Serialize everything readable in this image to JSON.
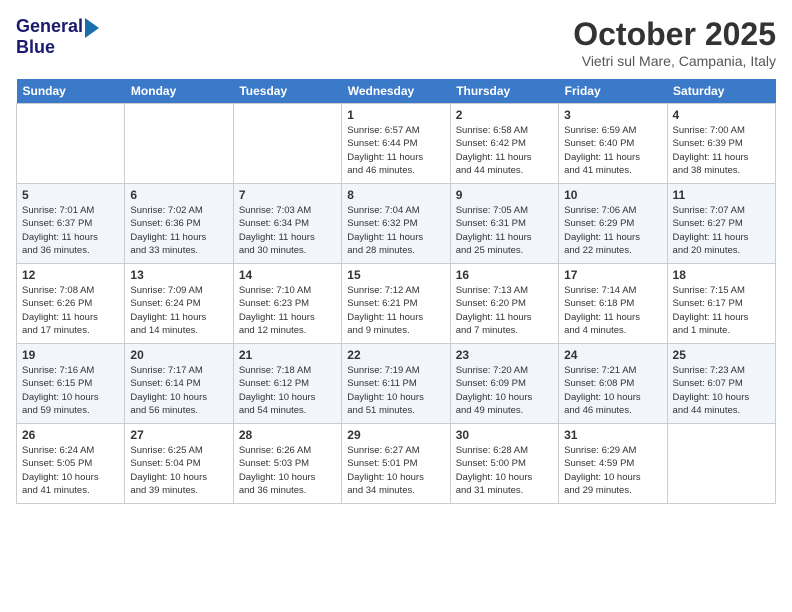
{
  "header": {
    "logo_line1": "General",
    "logo_line2": "Blue",
    "month": "October 2025",
    "location": "Vietri sul Mare, Campania, Italy"
  },
  "weekdays": [
    "Sunday",
    "Monday",
    "Tuesday",
    "Wednesday",
    "Thursday",
    "Friday",
    "Saturday"
  ],
  "weeks": [
    [
      {
        "day": "",
        "info": ""
      },
      {
        "day": "",
        "info": ""
      },
      {
        "day": "",
        "info": ""
      },
      {
        "day": "1",
        "info": "Sunrise: 6:57 AM\nSunset: 6:44 PM\nDaylight: 11 hours\nand 46 minutes."
      },
      {
        "day": "2",
        "info": "Sunrise: 6:58 AM\nSunset: 6:42 PM\nDaylight: 11 hours\nand 44 minutes."
      },
      {
        "day": "3",
        "info": "Sunrise: 6:59 AM\nSunset: 6:40 PM\nDaylight: 11 hours\nand 41 minutes."
      },
      {
        "day": "4",
        "info": "Sunrise: 7:00 AM\nSunset: 6:39 PM\nDaylight: 11 hours\nand 38 minutes."
      }
    ],
    [
      {
        "day": "5",
        "info": "Sunrise: 7:01 AM\nSunset: 6:37 PM\nDaylight: 11 hours\nand 36 minutes."
      },
      {
        "day": "6",
        "info": "Sunrise: 7:02 AM\nSunset: 6:36 PM\nDaylight: 11 hours\nand 33 minutes."
      },
      {
        "day": "7",
        "info": "Sunrise: 7:03 AM\nSunset: 6:34 PM\nDaylight: 11 hours\nand 30 minutes."
      },
      {
        "day": "8",
        "info": "Sunrise: 7:04 AM\nSunset: 6:32 PM\nDaylight: 11 hours\nand 28 minutes."
      },
      {
        "day": "9",
        "info": "Sunrise: 7:05 AM\nSunset: 6:31 PM\nDaylight: 11 hours\nand 25 minutes."
      },
      {
        "day": "10",
        "info": "Sunrise: 7:06 AM\nSunset: 6:29 PM\nDaylight: 11 hours\nand 22 minutes."
      },
      {
        "day": "11",
        "info": "Sunrise: 7:07 AM\nSunset: 6:27 PM\nDaylight: 11 hours\nand 20 minutes."
      }
    ],
    [
      {
        "day": "12",
        "info": "Sunrise: 7:08 AM\nSunset: 6:26 PM\nDaylight: 11 hours\nand 17 minutes."
      },
      {
        "day": "13",
        "info": "Sunrise: 7:09 AM\nSunset: 6:24 PM\nDaylight: 11 hours\nand 14 minutes."
      },
      {
        "day": "14",
        "info": "Sunrise: 7:10 AM\nSunset: 6:23 PM\nDaylight: 11 hours\nand 12 minutes."
      },
      {
        "day": "15",
        "info": "Sunrise: 7:12 AM\nSunset: 6:21 PM\nDaylight: 11 hours\nand 9 minutes."
      },
      {
        "day": "16",
        "info": "Sunrise: 7:13 AM\nSunset: 6:20 PM\nDaylight: 11 hours\nand 7 minutes."
      },
      {
        "day": "17",
        "info": "Sunrise: 7:14 AM\nSunset: 6:18 PM\nDaylight: 11 hours\nand 4 minutes."
      },
      {
        "day": "18",
        "info": "Sunrise: 7:15 AM\nSunset: 6:17 PM\nDaylight: 11 hours\nand 1 minute."
      }
    ],
    [
      {
        "day": "19",
        "info": "Sunrise: 7:16 AM\nSunset: 6:15 PM\nDaylight: 10 hours\nand 59 minutes."
      },
      {
        "day": "20",
        "info": "Sunrise: 7:17 AM\nSunset: 6:14 PM\nDaylight: 10 hours\nand 56 minutes."
      },
      {
        "day": "21",
        "info": "Sunrise: 7:18 AM\nSunset: 6:12 PM\nDaylight: 10 hours\nand 54 minutes."
      },
      {
        "day": "22",
        "info": "Sunrise: 7:19 AM\nSunset: 6:11 PM\nDaylight: 10 hours\nand 51 minutes."
      },
      {
        "day": "23",
        "info": "Sunrise: 7:20 AM\nSunset: 6:09 PM\nDaylight: 10 hours\nand 49 minutes."
      },
      {
        "day": "24",
        "info": "Sunrise: 7:21 AM\nSunset: 6:08 PM\nDaylight: 10 hours\nand 46 minutes."
      },
      {
        "day": "25",
        "info": "Sunrise: 7:23 AM\nSunset: 6:07 PM\nDaylight: 10 hours\nand 44 minutes."
      }
    ],
    [
      {
        "day": "26",
        "info": "Sunrise: 6:24 AM\nSunset: 5:05 PM\nDaylight: 10 hours\nand 41 minutes."
      },
      {
        "day": "27",
        "info": "Sunrise: 6:25 AM\nSunset: 5:04 PM\nDaylight: 10 hours\nand 39 minutes."
      },
      {
        "day": "28",
        "info": "Sunrise: 6:26 AM\nSunset: 5:03 PM\nDaylight: 10 hours\nand 36 minutes."
      },
      {
        "day": "29",
        "info": "Sunrise: 6:27 AM\nSunset: 5:01 PM\nDaylight: 10 hours\nand 34 minutes."
      },
      {
        "day": "30",
        "info": "Sunrise: 6:28 AM\nSunset: 5:00 PM\nDaylight: 10 hours\nand 31 minutes."
      },
      {
        "day": "31",
        "info": "Sunrise: 6:29 AM\nSunset: 4:59 PM\nDaylight: 10 hours\nand 29 minutes."
      },
      {
        "day": "",
        "info": ""
      }
    ]
  ]
}
